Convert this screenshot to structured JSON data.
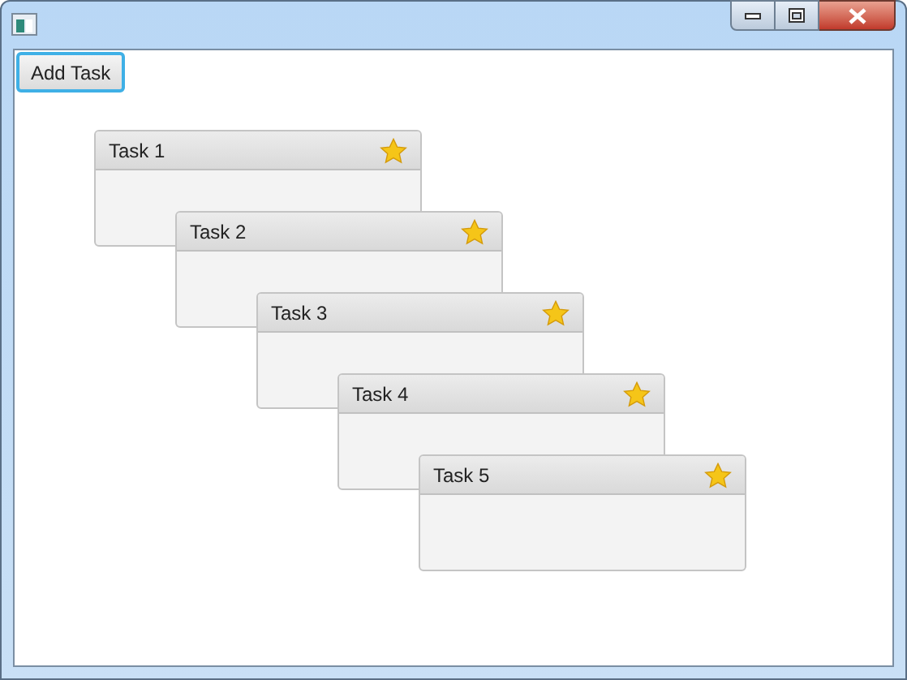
{
  "toolbar": {
    "button": "Add Task"
  },
  "tasks": [
    {
      "title": "Task 1"
    },
    {
      "title": "Task 2"
    },
    {
      "title": "Task 3"
    },
    {
      "title": "Task 4"
    },
    {
      "title": "Task 5"
    }
  ]
}
